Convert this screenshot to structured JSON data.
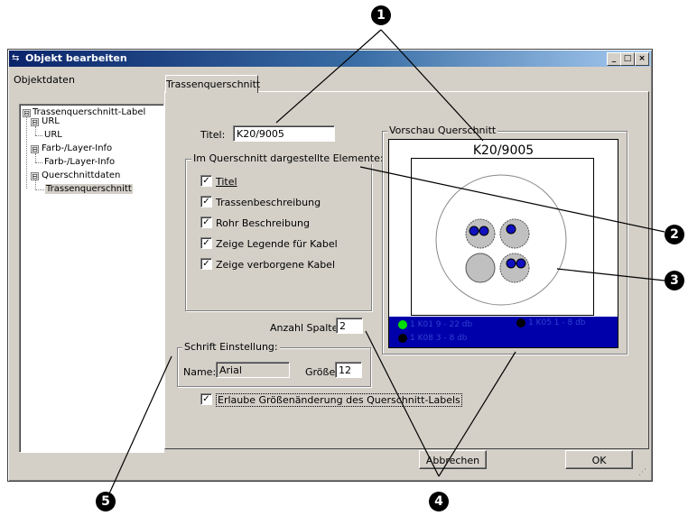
{
  "window": {
    "title": "Objekt bearbeiten",
    "buttons": [
      "_",
      "□",
      "×"
    ]
  },
  "left_panel": {
    "label": "Objektdaten",
    "tree": [
      {
        "label": "Trassenquerschnitt-Label",
        "expander": "⊟"
      },
      {
        "label": "URL",
        "expander": "⊟"
      },
      {
        "label": "URL"
      },
      {
        "label": "Farb-/Layer-Info",
        "expander": "⊟"
      },
      {
        "label": "Farb-/Layer-Info"
      },
      {
        "label": "Querschnittdaten",
        "expander": "⊟"
      },
      {
        "label": "Trassenquerschnitt",
        "selected": true
      }
    ]
  },
  "tab": {
    "label": "Trassenquerschnitt"
  },
  "form": {
    "titel_label": "Titel:",
    "titel_value": "K20/9005",
    "elements_group": "Im Querschnitt dargestellte Elemente:",
    "checkboxes": [
      {
        "label": "Titel",
        "checked": true
      },
      {
        "label": "Trassenbeschreibung",
        "checked": true
      },
      {
        "label": "Rohr Beschreibung",
        "checked": true
      },
      {
        "label": "Zeige Legende für Kabel",
        "checked": true
      },
      {
        "label": "Zeige verborgene Kabel",
        "checked": true
      }
    ],
    "spalten_label": "Anzahl Spalten:",
    "spalten_value": "2",
    "font_group": "Schrift Einstellung:",
    "name_label": "Name:",
    "name_value": "Arial",
    "groesse_label": "Größe:",
    "groesse_value": "12",
    "resize_label": "Erlaube Größenänderung des Querschnitt-Labels",
    "resize_checked": true
  },
  "preview": {
    "group_label": "Vorschau Querschnitt",
    "title": "K20/9005",
    "legend": [
      {
        "text": "1 K01 9 - 22 db",
        "color": "#00cc00"
      },
      {
        "text": "1 K05 1 - 8 db",
        "color": "#000000"
      },
      {
        "text": "1 K08 3 - 8 db",
        "color": "#000000"
      }
    ],
    "legend_bg": "#0000aa"
  },
  "buttons": {
    "cancel": "Abbrechen",
    "ok": "OK"
  },
  "annotations": [
    "1",
    "2",
    "3",
    "4",
    "5"
  ],
  "check_mark": "✓"
}
